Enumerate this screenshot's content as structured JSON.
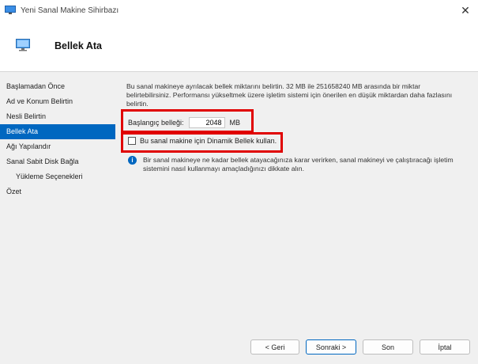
{
  "window": {
    "title": "Yeni Sanal Makine Sihirbazı",
    "close_glyph": "✕"
  },
  "header": {
    "title": "Bellek Ata"
  },
  "sidebar": {
    "items": [
      {
        "label": "Başlamadan Önce"
      },
      {
        "label": "Ad ve Konum Belirtin"
      },
      {
        "label": "Nesli Belirtin"
      },
      {
        "label": "Bellek Ata"
      },
      {
        "label": "Ağı Yapılandır"
      },
      {
        "label": "Sanal Sabit Disk Bağla"
      },
      {
        "label": "Yükleme Seçenekleri"
      },
      {
        "label": "Özet"
      }
    ]
  },
  "main": {
    "description": "Bu sanal makineye ayrılacak bellek miktarını belirtin. 32 MB ile 251658240 MB arasında bir miktar belirtebilirsiniz. Performansı yükseltmek üzere işletim sistemi için önerilen en düşük miktardan daha fazlasını belirtin.",
    "startup_memory_label": "Başlangıç belleği:",
    "startup_memory_value": "2048",
    "startup_memory_unit": "MB",
    "dynamic_memory_label": "Bu sanal makine için Dinamik Bellek kullan.",
    "info_text": "Bir sanal makineye ne kadar bellek atayacağınıza karar verirken, sanal makineyi ve çalıştıracağı işletim sistemini nasıl kullanmayı amaçladığınızı dikkate alın."
  },
  "footer": {
    "back_label": "< Geri",
    "next_label": "Sonraki >",
    "finish_label": "Son",
    "cancel_label": "İptal"
  },
  "colors": {
    "accent": "#0067c0",
    "highlight": "#e00000"
  }
}
